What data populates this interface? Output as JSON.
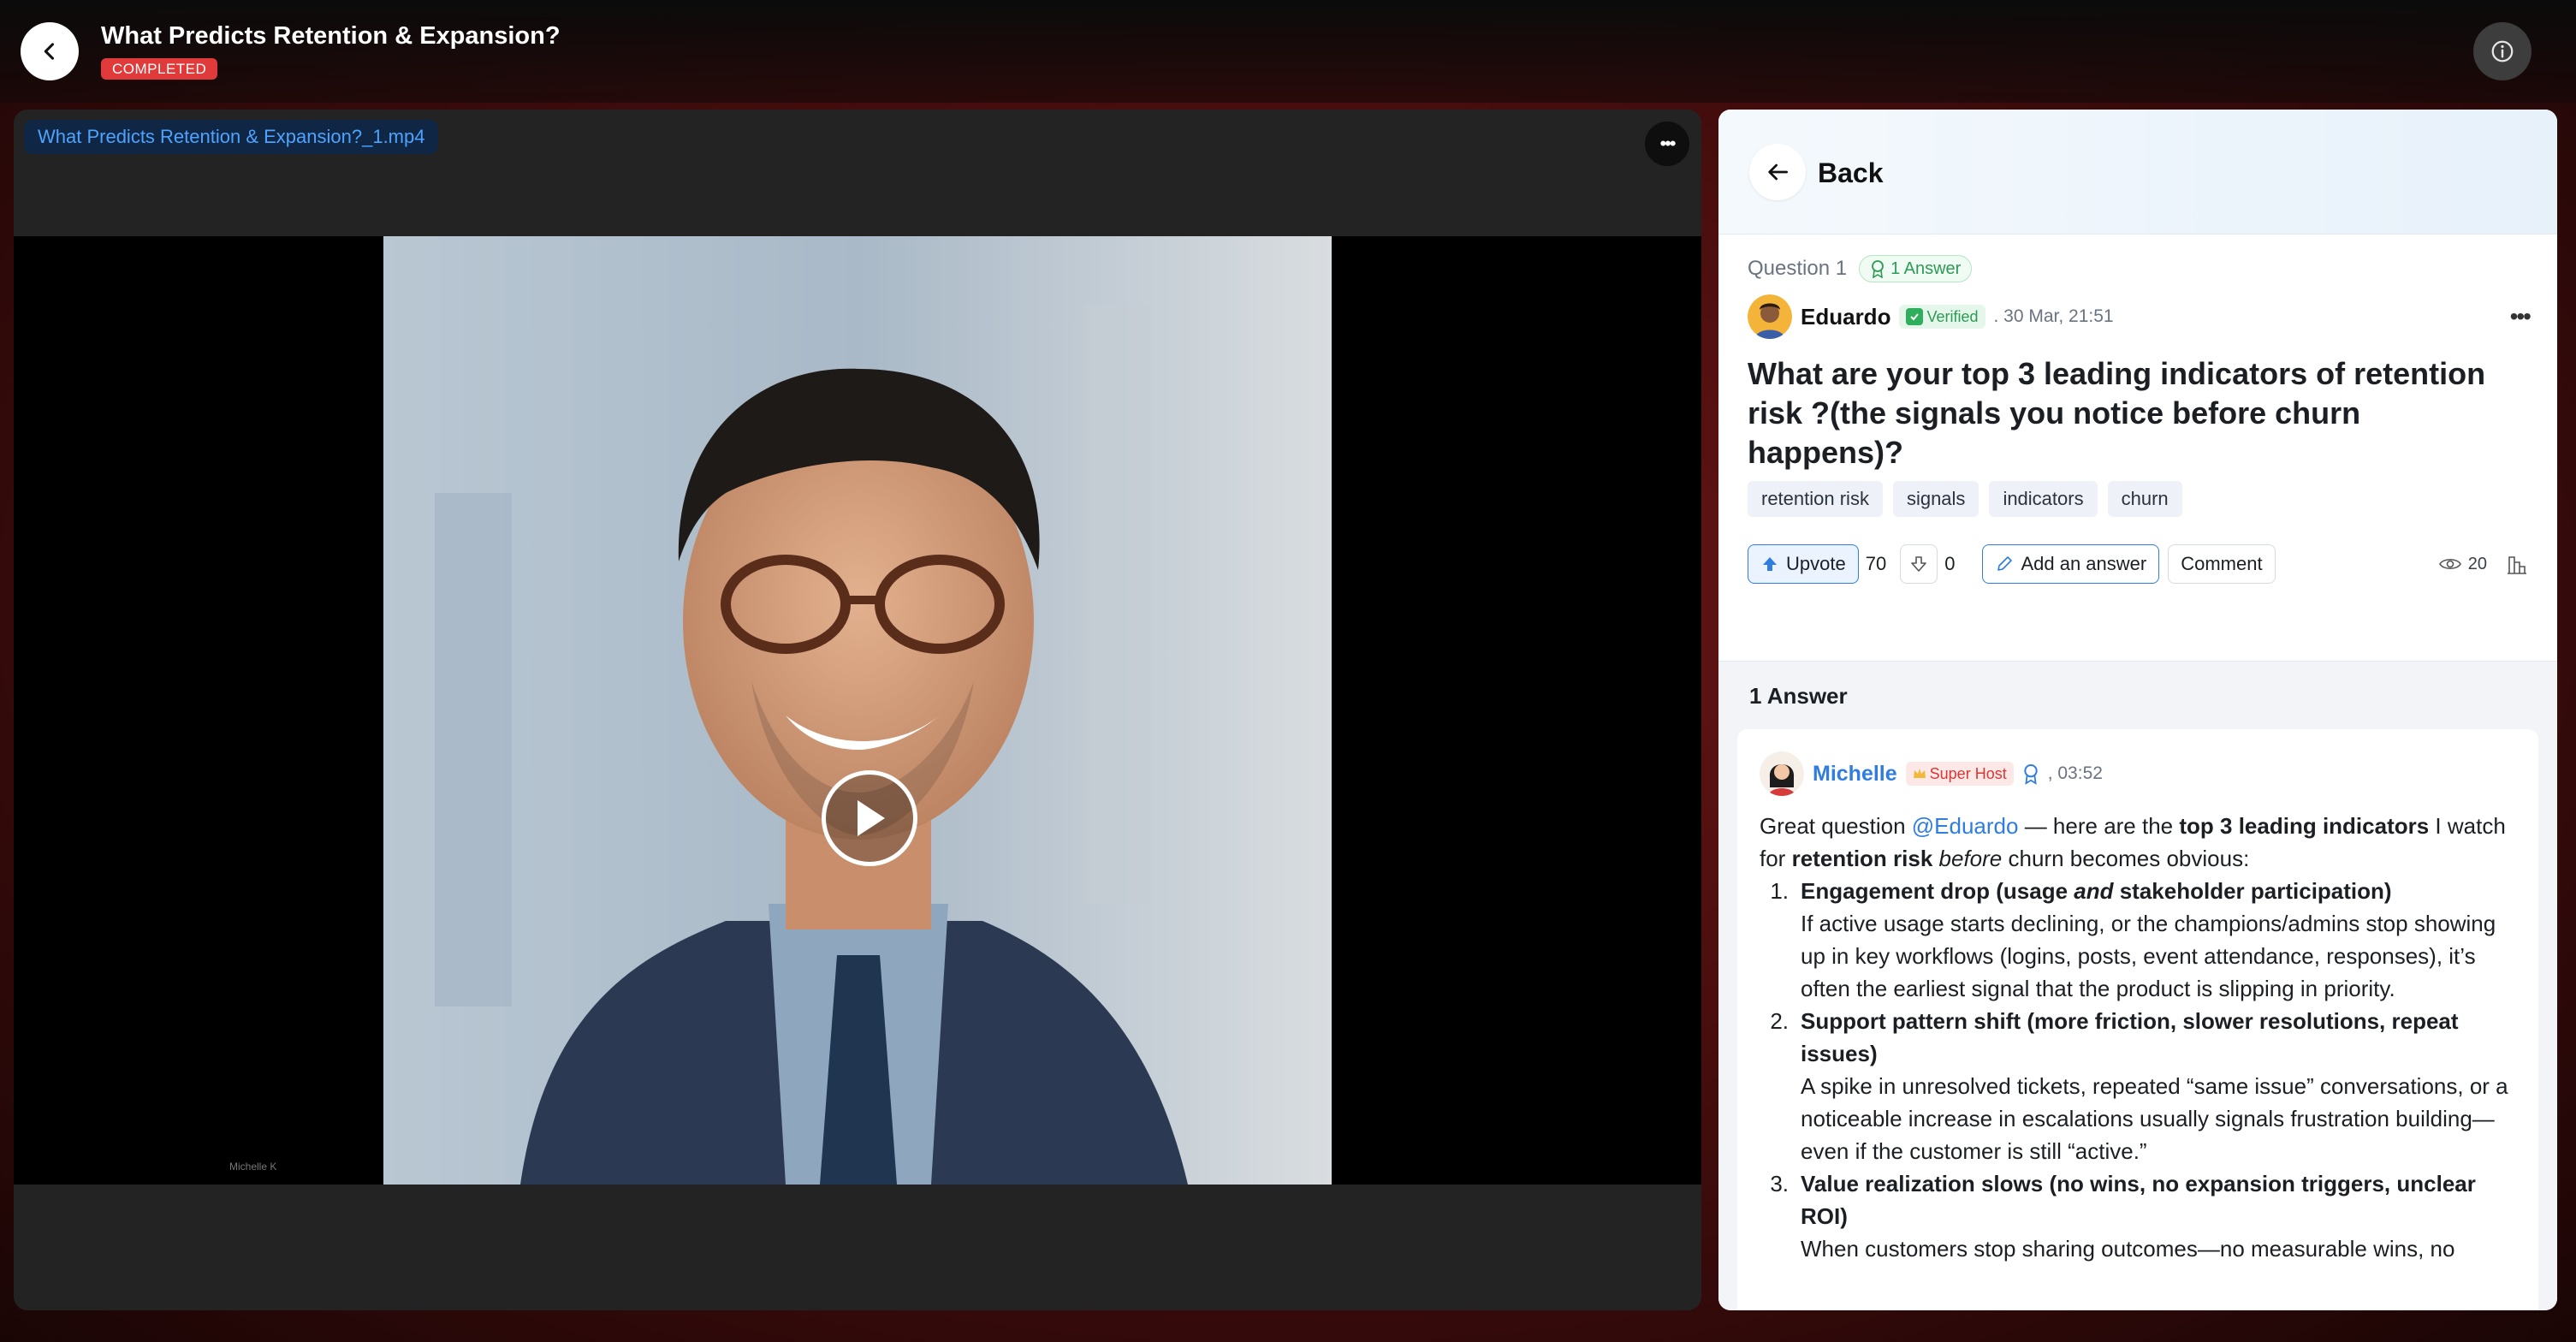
{
  "header": {
    "title": "What Predicts Retention & Expansion?",
    "status_badge": "COMPLETED"
  },
  "video": {
    "file_name": "What Predicts Retention & Expansion?_1.mp4",
    "more_label": "•••",
    "watermark": "Michelle K"
  },
  "qa_panel": {
    "back_label": "Back",
    "question": {
      "number_label": "Question 1",
      "answers_count_label": "1 Answer",
      "author": "Eduardo",
      "verified_label": "Verified",
      "timestamp": ". 30 Mar, 21:51",
      "more_label": "•••",
      "title": "What are your top 3 leading indicators of retention risk ?(the signals you notice before churn happens)?",
      "tags": [
        "retention risk",
        "signals",
        "indicators",
        "churn"
      ],
      "upvote_label": "Upvote",
      "upvote_count": "70",
      "downvote_count": "0",
      "add_answer_label": "Add an answer",
      "comment_label": "Comment",
      "views": "20"
    },
    "answers_heading": "1 Answer",
    "answer": {
      "author": "Michelle",
      "badge": "Super Host",
      "time": ", 03:52",
      "intro_1": "Great question ",
      "mention": "@Eduardo",
      "intro_2": " — here are the ",
      "intro_bold": "top 3 leading indicators",
      "intro_3": " I watch for ",
      "intro_bold_2": "retention risk",
      "intro_italic": "before",
      "intro_4": " churn becomes obvious:",
      "items": [
        {
          "num": "1.",
          "title_a": "Engagement drop (usage ",
          "title_italic": "and",
          "title_b": " stakeholder participation)",
          "body": "If active usage starts declining, or the champions/admins stop showing up in key workflows (logins, posts, event attendance, responses), it’s often the earliest signal that the product is slipping in priority."
        },
        {
          "num": "2.",
          "title_a": "Support pattern shift (more friction, slower resolutions, repeat issues)",
          "title_italic": "",
          "title_b": "",
          "body": "A spike in unresolved tickets, repeated “same issue” conversations, or a noticeable increase in escalations usually signals frustration building—even if the customer is still “active.”"
        },
        {
          "num": "3.",
          "title_a": "Value realization slows (no wins, no expansion triggers, unclear ROI)",
          "title_italic": "",
          "title_b": "",
          "body": "When customers stop sharing outcomes—no measurable wins, no"
        }
      ]
    }
  },
  "colors": {
    "accent_blue": "#2f7de1",
    "completed_red": "#e03a3a",
    "verified_green": "#2c9b54",
    "superhost_red": "#d93636"
  }
}
